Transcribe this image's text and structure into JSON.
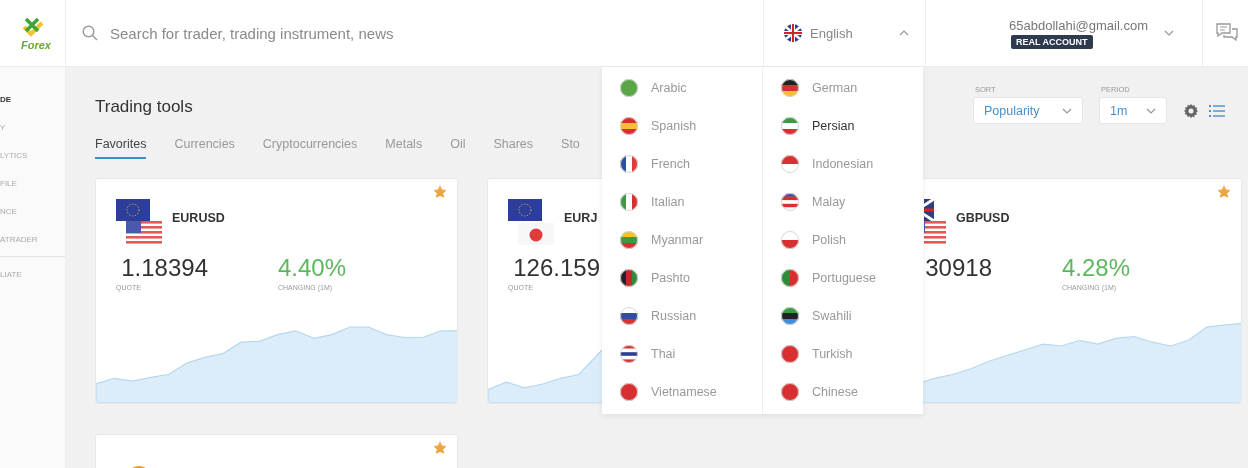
{
  "logo": {
    "text": "Forex"
  },
  "search": {
    "placeholder": "Search for trader, trading instrument, news"
  },
  "language": {
    "value": "English",
    "expanded": true
  },
  "account": {
    "email": "65abdollahi@gmail.com",
    "badge": "REAL ACCOUNT",
    "expanded": false
  },
  "sidebar": {
    "items": [
      {
        "label": "DE",
        "selected": true
      },
      {
        "label": "Y",
        "selected": false
      },
      {
        "label": "LYTICS",
        "selected": false
      },
      {
        "label": "FILE",
        "selected": false
      },
      {
        "label": "NCE",
        "selected": false
      },
      {
        "label": "ATRADER",
        "selected": false
      },
      {
        "label": "LIATE",
        "selected": false
      }
    ]
  },
  "page": {
    "title": "Trading tools"
  },
  "tabs": [
    {
      "label": "Favorites",
      "selected": true
    },
    {
      "label": "Currencies",
      "selected": false
    },
    {
      "label": "Cryptocurrencies",
      "selected": false
    },
    {
      "label": "Metals",
      "selected": false
    },
    {
      "label": "Oil",
      "selected": false
    },
    {
      "label": "Shares",
      "selected": false
    },
    {
      "label": "Sto",
      "selected": false
    }
  ],
  "sort": {
    "label": "SORT",
    "value": "Popularity"
  },
  "period": {
    "label": "PERIOD",
    "value": "1m"
  },
  "cards": [
    {
      "name": "EURUSD",
      "quote": "1.18394",
      "quote_label": "QUOTE",
      "change": "4.40%",
      "change_label": "CHANGING (1M)",
      "favorite": true
    },
    {
      "name": "EURJ",
      "quote": "126.159",
      "quote_label": "QUOTE"
    },
    {
      "name": "GBPUSD",
      "quote": "30918",
      "change": "4.28%",
      "change_label": "CHANGING (1M)",
      "favorite": true
    },
    {
      "favorite": true
    }
  ],
  "language_menu": {
    "columns": [
      {
        "items": [
          {
            "label": "Arabic",
            "selected": false
          },
          {
            "label": "Spanish",
            "selected": false
          },
          {
            "label": "French",
            "selected": false
          },
          {
            "label": "Italian",
            "selected": false
          },
          {
            "label": "Myanmar",
            "selected": false
          },
          {
            "label": "Pashto",
            "selected": false
          },
          {
            "label": "Russian",
            "selected": false
          },
          {
            "label": "Thai",
            "selected": false
          },
          {
            "label": "Vietnamese",
            "selected": false
          }
        ]
      },
      {
        "items": [
          {
            "label": "German",
            "selected": false
          },
          {
            "label": "Persian",
            "selected": true
          },
          {
            "label": "Indonesian",
            "selected": false
          },
          {
            "label": "Malay",
            "selected": false
          },
          {
            "label": "Polish",
            "selected": false
          },
          {
            "label": "Portuguese",
            "selected": false
          },
          {
            "label": "Swahili",
            "selected": false
          },
          {
            "label": "Turkish",
            "selected": false
          },
          {
            "label": "Chinese",
            "selected": false
          }
        ]
      }
    ]
  }
}
